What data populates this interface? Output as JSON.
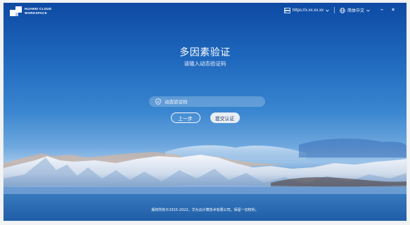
{
  "brand": {
    "line1": "HUAWEI CLOUD",
    "line2": "WORKSPACE"
  },
  "topbar": {
    "server_url": "https://x.xx.xx.xx",
    "language": "简体中文",
    "minimize_label": "–",
    "close_label": "×"
  },
  "main": {
    "title": "多因素验证",
    "subtitle": "请输入动态验证码",
    "otp_placeholder": "动态验证码",
    "prev_button": "上一步",
    "submit_button": "提交认证"
  },
  "footer": {
    "copyright": "版权所有©2015-2022，华为云计算技术有限公司。保留一切权利。"
  },
  "colors": {
    "sky_top": "#0d4aa3",
    "horizon_glow": "#9cc3e8",
    "submit_button_bg": "#e9eef5",
    "submit_button_text": "#1f3a66"
  }
}
